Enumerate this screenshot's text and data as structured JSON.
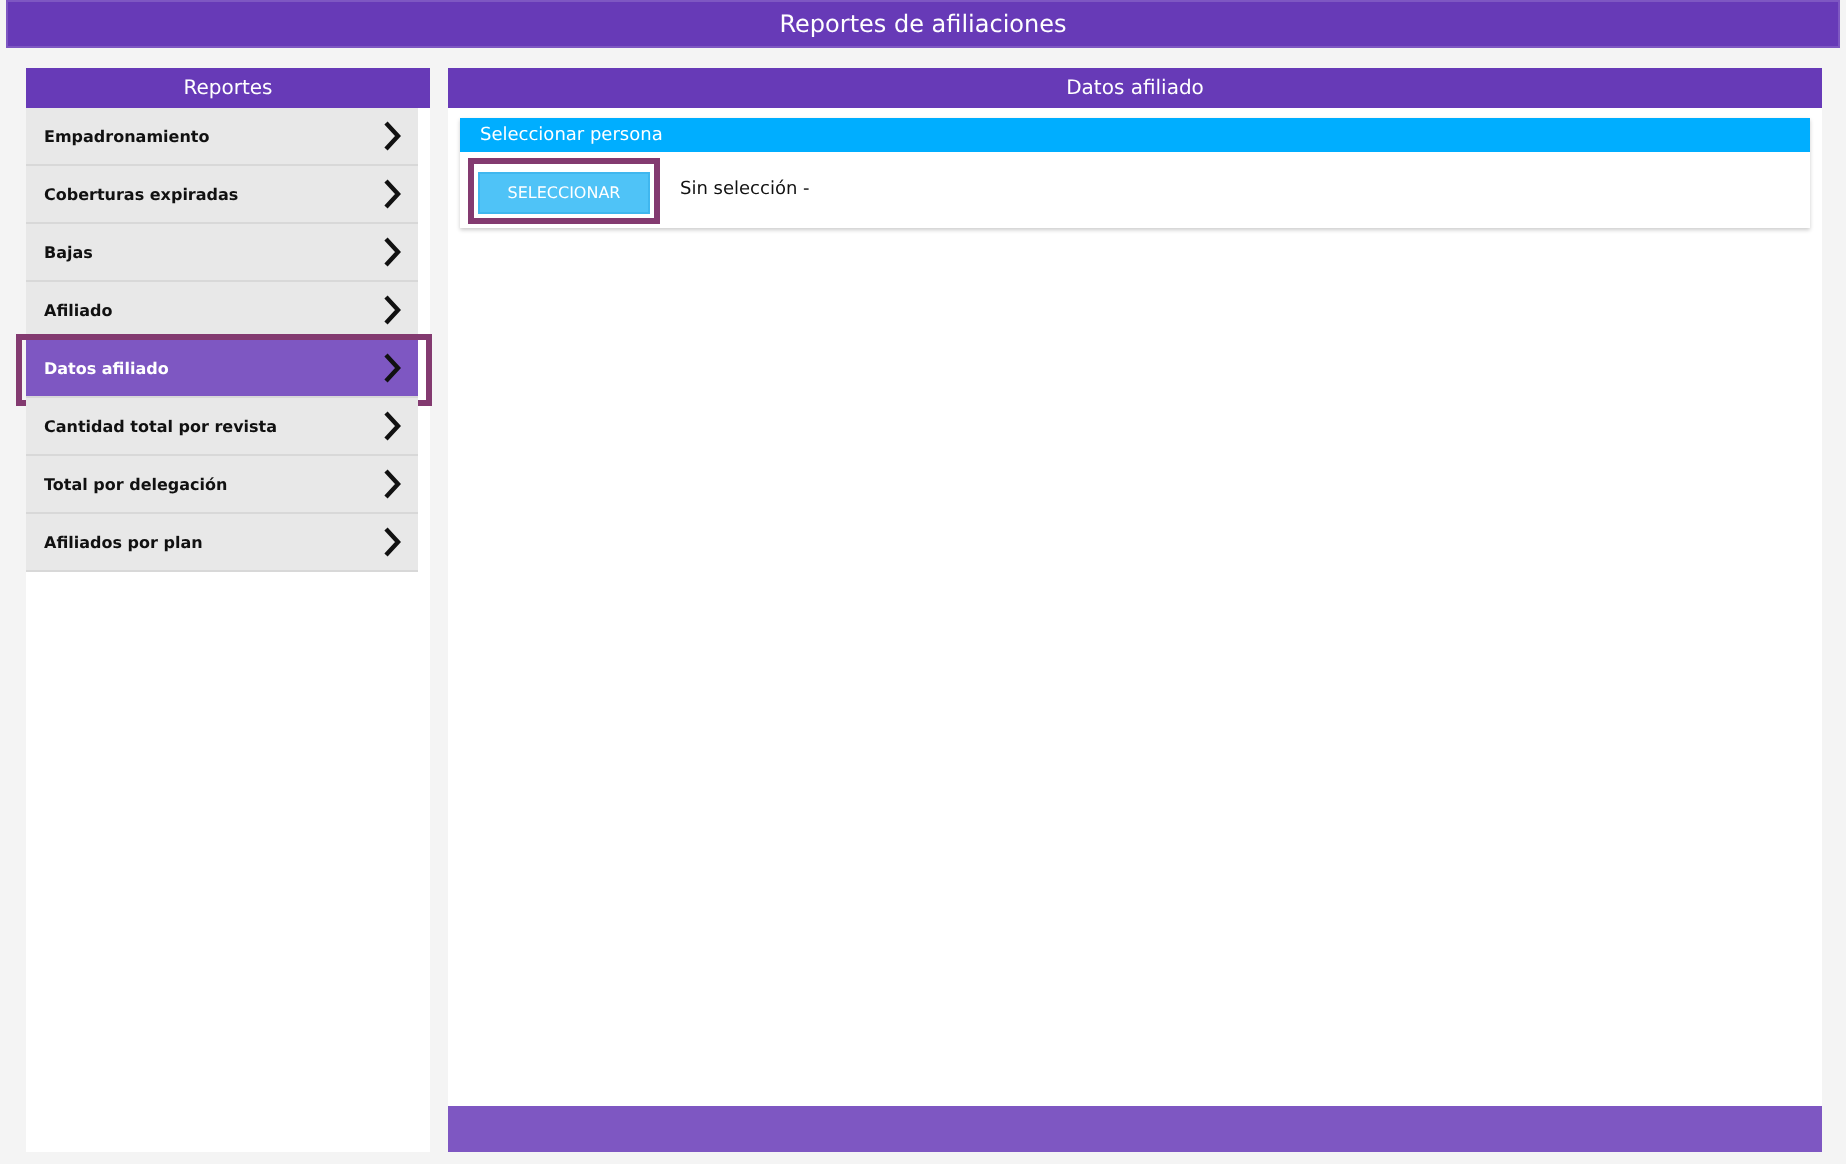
{
  "window": {
    "title": "Reportes de afiliaciones"
  },
  "sidebar": {
    "title": "Reportes",
    "items": [
      {
        "label": "Empadronamiento",
        "selected": false
      },
      {
        "label": "Coberturas expiradas",
        "selected": false
      },
      {
        "label": "Bajas",
        "selected": false
      },
      {
        "label": "Afiliado",
        "selected": false
      },
      {
        "label": "Datos afiliado",
        "selected": true
      },
      {
        "label": "Cantidad total por revista",
        "selected": false
      },
      {
        "label": "Total por delegación",
        "selected": false
      },
      {
        "label": "Afiliados por plan",
        "selected": false
      }
    ]
  },
  "detail": {
    "title": "Datos afiliado",
    "section": {
      "title": "Seleccionar persona",
      "button": {
        "label": "SELECCIONAR",
        "highlighted": true
      },
      "value": "Sin selección -"
    }
  }
}
